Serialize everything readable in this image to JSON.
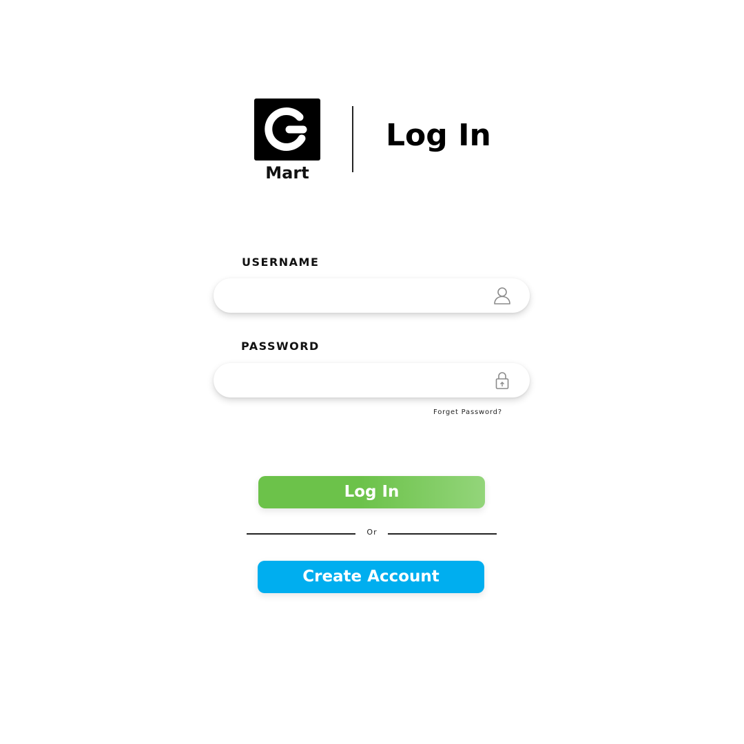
{
  "brand": {
    "logo_letter": "G",
    "name": "Mart",
    "logo_icon": "g-mart-logo"
  },
  "header": {
    "title": "Log In"
  },
  "form": {
    "username": {
      "label": "USERNAME",
      "value": "",
      "placeholder": "",
      "icon": "user-icon"
    },
    "password": {
      "label": "PASSWORD",
      "value": "",
      "placeholder": "",
      "icon": "lock-icon"
    },
    "forgot_password_label": "Forget Password?"
  },
  "actions": {
    "login_label": "Log In",
    "separator_label": "Or",
    "create_account_label": "Create Account"
  },
  "colors": {
    "login_button": "#6cc24a",
    "login_button_end": "#93d57a",
    "create_account_button": "#00aeef",
    "logo_background": "#000000"
  }
}
